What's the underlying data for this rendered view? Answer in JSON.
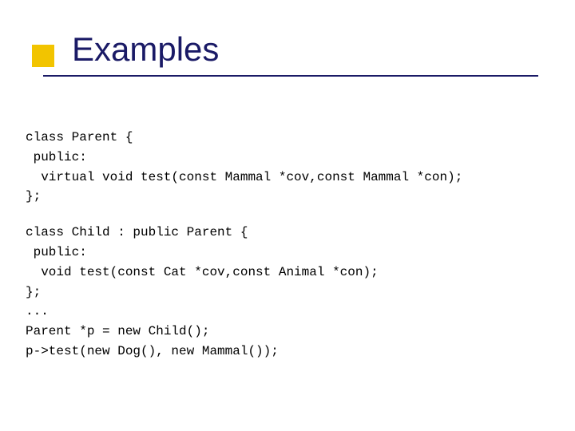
{
  "slide": {
    "title": "Examples"
  },
  "code": {
    "block1": "class Parent {\n public:\n  virtual void test(const Mammal *cov,const Mammal *con);\n};",
    "block2": "class Child : public Parent {\n public:\n  void test(const Cat *cov,const Animal *con);\n};\n...\nParent *p = new Child();\np->test(new Dog(), new Mammal());"
  }
}
